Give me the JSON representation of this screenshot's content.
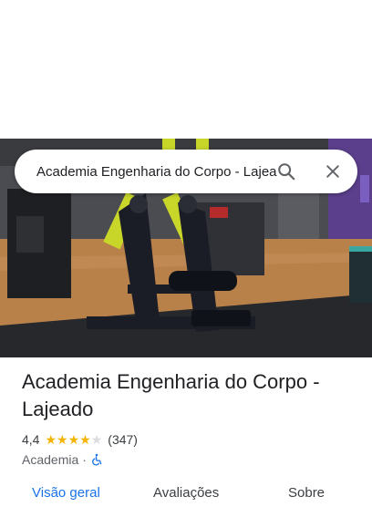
{
  "search": {
    "query": "Academia Engenharia do Corpo - Lajeado",
    "search_icon": "search-icon",
    "close_icon": "close-icon"
  },
  "photo": {
    "subject": "gym-equipment-photo"
  },
  "place": {
    "title": "Academia Engenharia do Corpo - Lajeado",
    "rating": "4,4",
    "rating_value": 4.4,
    "rating_max": 5,
    "review_count": "(347)",
    "category": "Academia",
    "separator": "·",
    "accessibility_icon": "wheelchair-icon"
  },
  "tabs": [
    {
      "label": "Visão geral",
      "active": true
    },
    {
      "label": "Avaliações",
      "active": false
    },
    {
      "label": "Sobre",
      "active": false
    }
  ],
  "colors": {
    "accent": "#1a73e8",
    "star": "#f4b400",
    "text_primary": "#202124",
    "text_secondary": "#5f6368"
  }
}
